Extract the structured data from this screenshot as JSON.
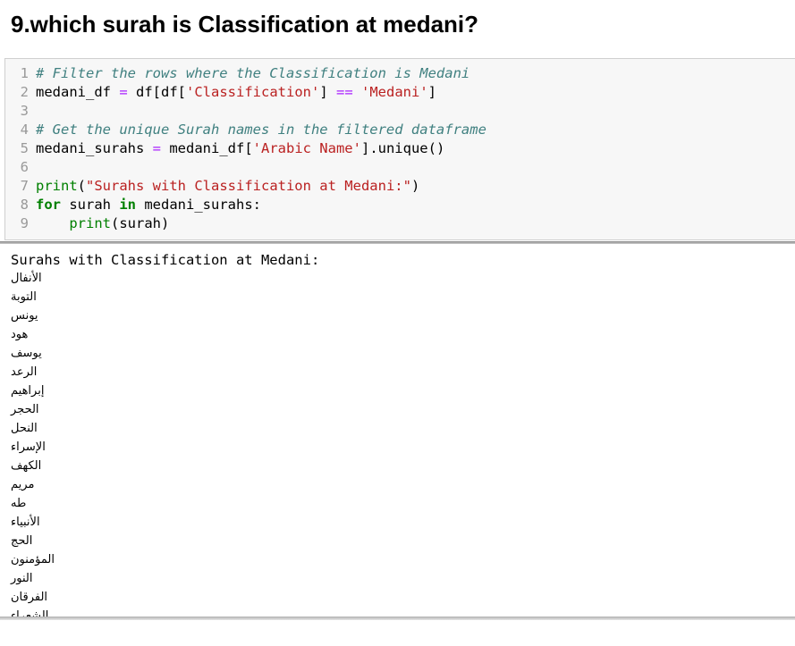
{
  "heading": "9.which surah is Classification at medani?",
  "code_lines": [
    {
      "num": "1",
      "parts": [
        {
          "t": "# Filter the rows where the Classification is Medani",
          "c": "comment"
        }
      ]
    },
    {
      "num": "2",
      "parts": [
        {
          "t": "medani_df ",
          "c": "code"
        },
        {
          "t": "=",
          "c": "op"
        },
        {
          "t": " df[df[",
          "c": "code"
        },
        {
          "t": "'Classification'",
          "c": "string"
        },
        {
          "t": "] ",
          "c": "code"
        },
        {
          "t": "==",
          "c": "op"
        },
        {
          "t": " ",
          "c": "code"
        },
        {
          "t": "'Medani'",
          "c": "string"
        },
        {
          "t": "]",
          "c": "code"
        }
      ]
    },
    {
      "num": "3",
      "parts": []
    },
    {
      "num": "4",
      "parts": [
        {
          "t": "# Get the unique Surah names in the filtered dataframe",
          "c": "comment"
        }
      ]
    },
    {
      "num": "5",
      "parts": [
        {
          "t": "medani_surahs ",
          "c": "code"
        },
        {
          "t": "=",
          "c": "op"
        },
        {
          "t": " medani_df[",
          "c": "code"
        },
        {
          "t": "'Arabic Name'",
          "c": "string"
        },
        {
          "t": "].unique()",
          "c": "code"
        }
      ]
    },
    {
      "num": "6",
      "parts": []
    },
    {
      "num": "7",
      "parts": [
        {
          "t": "print",
          "c": "builtin"
        },
        {
          "t": "(",
          "c": "code"
        },
        {
          "t": "\"Surahs with Classification at Medani:\"",
          "c": "string"
        },
        {
          "t": ")",
          "c": "code"
        }
      ]
    },
    {
      "num": "8",
      "parts": [
        {
          "t": "for",
          "c": "keyword"
        },
        {
          "t": " surah ",
          "c": "code"
        },
        {
          "t": "in",
          "c": "keyword"
        },
        {
          "t": " medani_surahs:",
          "c": "code"
        }
      ]
    },
    {
      "num": "9",
      "parts": [
        {
          "t": "    ",
          "c": "code"
        },
        {
          "t": "print",
          "c": "builtin"
        },
        {
          "t": "(surah)",
          "c": "code"
        }
      ]
    }
  ],
  "output": {
    "header": "Surahs with Classification at Medani:",
    "surahs": [
      "الأنفال",
      "التوبة",
      "يونس",
      "هود",
      "يوسف",
      "الرعد",
      "إبراهيم",
      "الحجر",
      "النحل",
      "الإسراء",
      "الكهف",
      "مريم",
      "طه",
      "الأنبياء",
      "الحج",
      "المؤمنون",
      "النور",
      "الفرقان",
      "الشعراء"
    ]
  }
}
